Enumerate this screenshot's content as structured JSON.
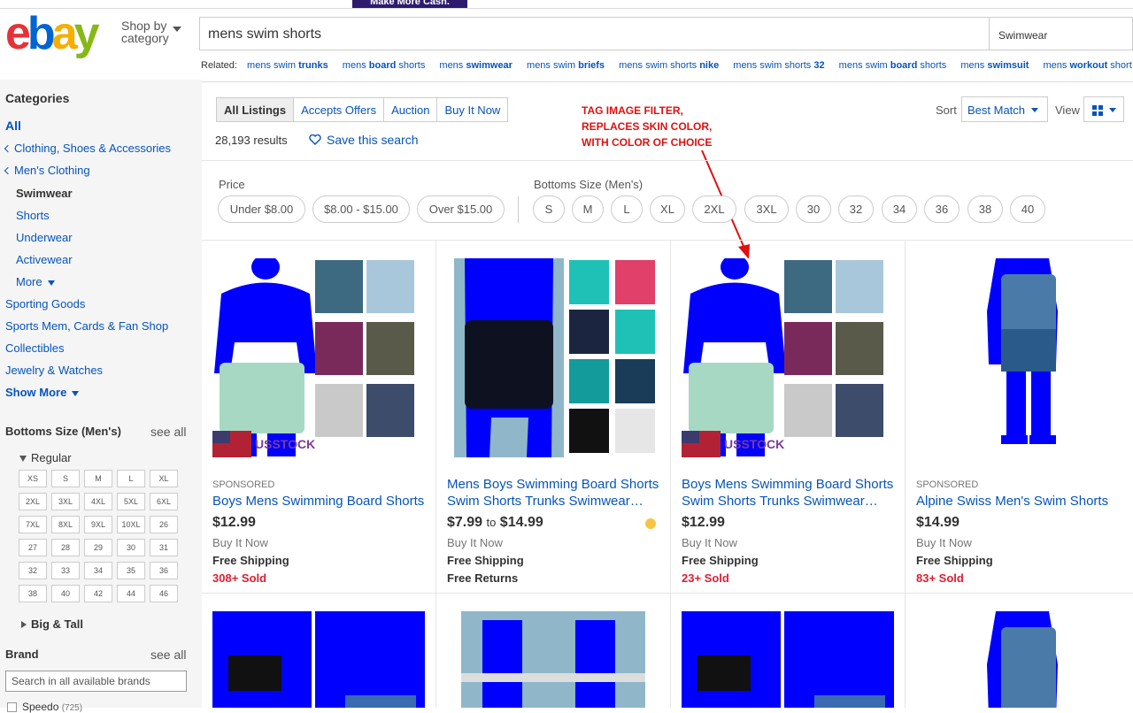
{
  "banner": {
    "text": "Make More Cash."
  },
  "header": {
    "logo": [
      "e",
      "b",
      "a",
      "y"
    ],
    "shop_by": "Shop by",
    "category": "category",
    "search_value": "mens swim shorts",
    "category_select": "Swimwear"
  },
  "related": {
    "label": "Related:",
    "items": [
      {
        "pre": "mens swim ",
        "bold": "trunks"
      },
      {
        "pre": "mens ",
        "bold": "board",
        "post": " shorts"
      },
      {
        "pre": "mens ",
        "bold": "swimwear"
      },
      {
        "pre": "mens swim ",
        "bold": "briefs"
      },
      {
        "pre": "mens swim shorts ",
        "bold": "nike"
      },
      {
        "pre": "mens swim shorts ",
        "bold": "32"
      },
      {
        "pre": "mens swim ",
        "bold": "board",
        "post": " shorts"
      },
      {
        "pre": "mens ",
        "bold": "swimsuit"
      },
      {
        "pre": "mens ",
        "bold": "workout",
        "post": " short…"
      }
    ]
  },
  "sidebar": {
    "categories_heading": "Categories",
    "all": "All",
    "cat1": "Clothing, Shoes & Accessories",
    "cat2": "Men's Clothing",
    "cat_current": "Swimwear",
    "sub": [
      "Shorts",
      "Underwear",
      "Activewear"
    ],
    "more": "More",
    "others": [
      "Sporting Goods",
      "Sports Mem, Cards & Fan Shop",
      "Collectibles",
      "Jewelry & Watches"
    ],
    "show_more": "Show More",
    "bottoms_heading": "Bottoms Size (Men's)",
    "see_all": "see all",
    "regular": "Regular",
    "sizes": [
      "XS",
      "S",
      "M",
      "L",
      "XL",
      "2XL",
      "3XL",
      "4XL",
      "5XL",
      "6XL",
      "7XL",
      "8XL",
      "9XL",
      "10XL",
      "26",
      "27",
      "28",
      "29",
      "30",
      "31",
      "32",
      "33",
      "34",
      "35",
      "36",
      "38",
      "40",
      "42",
      "44",
      "46"
    ],
    "big_tall": "Big & Tall",
    "brand_heading": "Brand",
    "brand_see_all": "see all",
    "brand_placeholder": "Search in all available brands",
    "speedo": "Speedo",
    "speedo_count": "(725)"
  },
  "toolbar": {
    "tabs": [
      "All Listings",
      "Accepts Offers",
      "Auction",
      "Buy It Now"
    ],
    "results": "28,193 results",
    "save_search": "Save this search",
    "annotation": [
      "TAG IMAGE FILTER,",
      "REPLACES SKIN COLOR,",
      "WITH COLOR OF CHOICE"
    ],
    "sort_label": "Sort",
    "sort_value": "Best Match",
    "view_label": "View"
  },
  "filters": {
    "price_label": "Price",
    "price": [
      "Under $8.00",
      "$8.00 - $15.00",
      "Over $15.00"
    ],
    "size_label": "Bottoms Size (Men's)",
    "sizes": [
      "S",
      "M",
      "L",
      "XL",
      "2XL",
      "3XL",
      "30",
      "32",
      "34",
      "36",
      "38",
      "40"
    ]
  },
  "listings": [
    {
      "sponsored": "SPONSORED",
      "title": "Boys Mens Swimming Board Shorts",
      "price": "$12.99",
      "bin": "Buy It Now",
      "ship": "Free Shipping",
      "sold": "308+ Sold",
      "badge": "USSTOCK"
    },
    {
      "title1": "Mens Boys Swimming Board Shorts",
      "title2": "Swim Shorts Trunks Swimwear…",
      "price_lo": "$7.99",
      "to": "to",
      "price_hi": "$14.99",
      "bin": "Buy It Now",
      "ship": "Free Shipping",
      "returns": "Free Returns"
    },
    {
      "title1": "Boys Mens Swimming Board Shorts",
      "title2": "Swim Shorts Trunks Swimwear…",
      "price": "$12.99",
      "bin": "Buy It Now",
      "ship": "Free Shipping",
      "sold": "23+ Sold",
      "badge": "USSTOCK"
    },
    {
      "sponsored": "SPONSORED",
      "title": "Alpine Swiss Men's Swim Shorts",
      "price": "$14.99",
      "bin": "Buy It Now",
      "ship": "Free Shipping",
      "sold": "83+ Sold"
    }
  ],
  "colors": {
    "link": "#0654ba",
    "sold": "#dd1e31",
    "annotation": "#e01010",
    "filter_skin": "#0000ff"
  }
}
